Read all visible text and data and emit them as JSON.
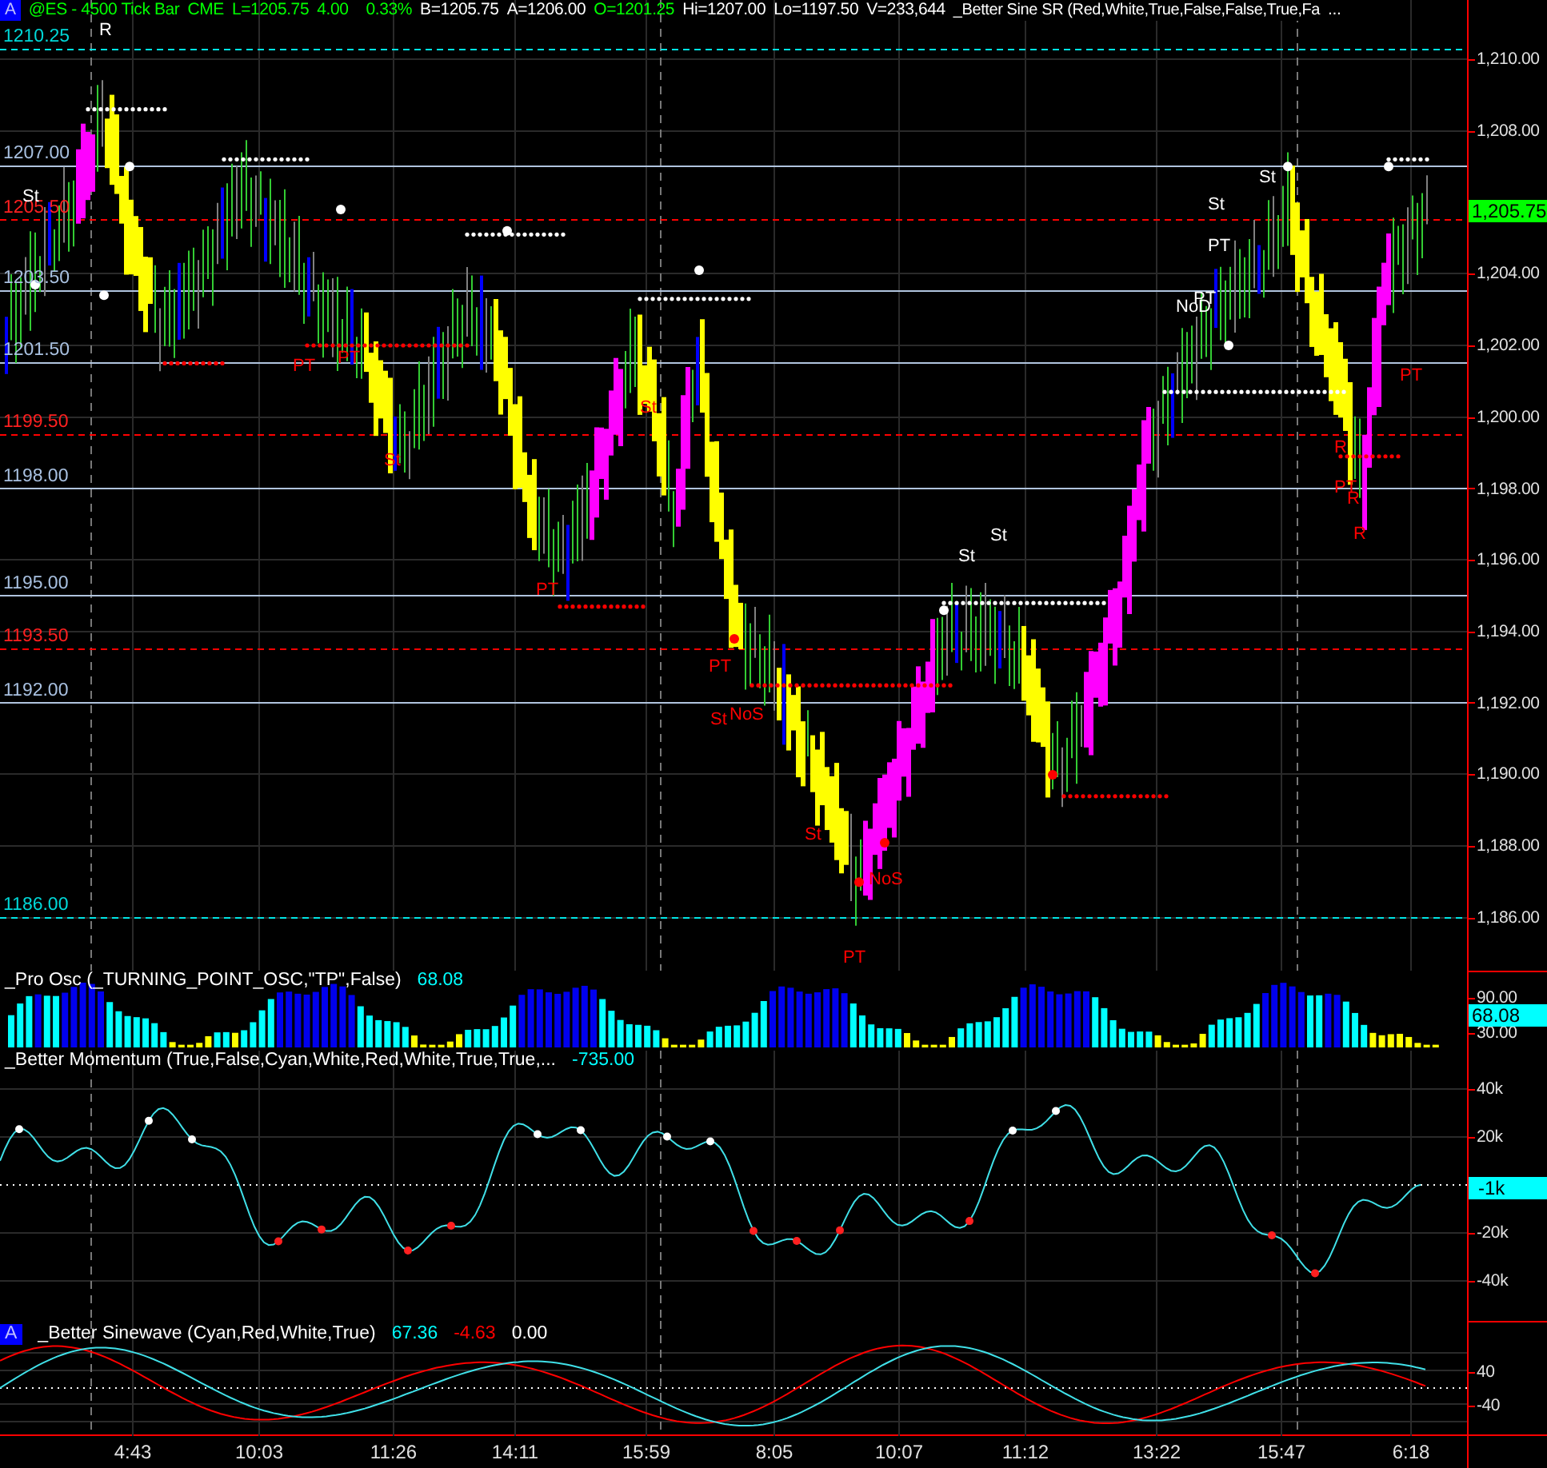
{
  "header": {
    "badge": "A",
    "symbol": "@ES - 4500 Tick Bar",
    "exchange": "CME",
    "last": "L=1205.75",
    "change": "4.00",
    "change_pct": "0.33%",
    "bid": "B=1205.75",
    "ask": "A=1206.00",
    "open": "O=1201.25",
    "high": "Hi=1207.00",
    "low": "Lo=1197.50",
    "volume": "V=233,644",
    "study": "_Better Sine SR (Red,White,True,False,False,True,Fa",
    "more": "..."
  },
  "price_levels": [
    {
      "label": "1210.25",
      "kind": "extreme"
    },
    {
      "label": "1207.00",
      "kind": "support"
    },
    {
      "label": "1205.50",
      "kind": "resistance"
    },
    {
      "label": "1203.50",
      "kind": "support"
    },
    {
      "label": "1201.50",
      "kind": "support"
    },
    {
      "label": "1199.50",
      "kind": "resistance"
    },
    {
      "label": "1198.00",
      "kind": "support"
    },
    {
      "label": "1195.00",
      "kind": "support"
    },
    {
      "label": "1193.50",
      "kind": "resistance"
    },
    {
      "label": "1192.00",
      "kind": "support"
    },
    {
      "label": "1186.00",
      "kind": "extreme"
    }
  ],
  "price_axis": {
    "ticks": [
      "1,210.00",
      "1,208.00",
      "1,204.00",
      "1,202.00",
      "1,200.00",
      "1,198.00",
      "1,196.00",
      "1,194.00",
      "1,192.00",
      "1,190.00",
      "1,188.00",
      "1,186.00"
    ],
    "last_price": "1,205.75"
  },
  "signals": [
    {
      "text": "R",
      "color": "#ffffff"
    },
    {
      "text": "St",
      "color": "#ffffff"
    },
    {
      "text": "PT",
      "color": "#ff0000"
    },
    {
      "text": "PT",
      "color": "#ff0000"
    },
    {
      "text": "St",
      "color": "#ff0000"
    },
    {
      "text": "PT",
      "color": "#ff0000"
    },
    {
      "text": "St",
      "color": "#ff0000"
    },
    {
      "text": "PT",
      "color": "#ff0000"
    },
    {
      "text": "St",
      "color": "#ff0000"
    },
    {
      "text": "NoS",
      "color": "#ff0000"
    },
    {
      "text": "St",
      "color": "#ff0000"
    },
    {
      "text": "NoS",
      "color": "#ff0000"
    },
    {
      "text": "PT",
      "color": "#ff0000"
    },
    {
      "text": "St",
      "color": "#ffffff"
    },
    {
      "text": "St",
      "color": "#ffffff"
    },
    {
      "text": "St",
      "color": "#ffffff"
    },
    {
      "text": "PT",
      "color": "#ffffff"
    },
    {
      "text": "NoD",
      "color": "#ffffff"
    },
    {
      "text": "PT",
      "color": "#ffffff"
    },
    {
      "text": "St",
      "color": "#ffffff"
    },
    {
      "text": "PT",
      "color": "#ff0000"
    },
    {
      "text": "R",
      "color": "#ff0000"
    },
    {
      "text": "PT",
      "color": "#ff0000"
    },
    {
      "text": "R",
      "color": "#ff0000"
    },
    {
      "text": "R",
      "color": "#ff0000"
    }
  ],
  "pro_osc": {
    "title": "_Pro Osc (_TURNING_POINT_OSC,\"TP\",False)",
    "value": "68.08",
    "ticks": [
      "90.00",
      "30.00"
    ],
    "badge": "68.08"
  },
  "momentum": {
    "title": "_Better Momentum (True,False,Cyan,White,Red,White,True,True,...",
    "value": "-735.00",
    "ticks": [
      "40k",
      "20k",
      "-20k",
      "-40k"
    ],
    "badge": "-1k"
  },
  "sinewave": {
    "badge": "A",
    "title": "_Better Sinewave (Cyan,Red,White,True)",
    "values": [
      {
        "text": "67.36",
        "color": "#00ffff"
      },
      {
        "text": "-4.63",
        "color": "#ff0000"
      },
      {
        "text": "0.00",
        "color": "#ffffff"
      }
    ],
    "ticks": [
      "40",
      "-40"
    ]
  },
  "time_axis": [
    "4:43",
    "10:03",
    "11:26",
    "14:11",
    "15:59",
    "8:05",
    "10:07",
    "11:12",
    "13:22",
    "15:47",
    "6:18"
  ]
}
